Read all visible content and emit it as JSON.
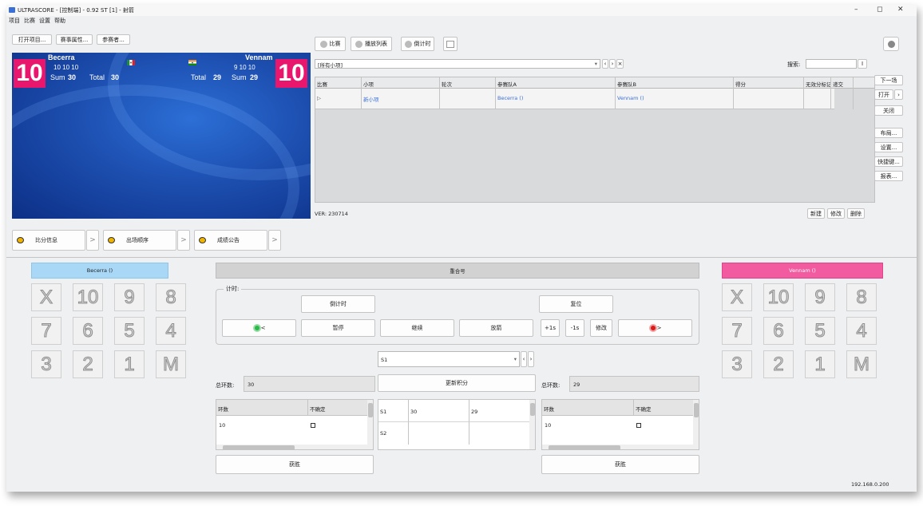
{
  "window": {
    "title": "ULTRASCORE - [控制端] - 0.92 ST [1] - 射箭",
    "controls": [
      "–",
      "◻",
      "✕"
    ]
  },
  "menu": [
    "项目",
    "比赛",
    "设置",
    "帮助"
  ],
  "top_buttons": [
    "打开项目...",
    "赛事属性...",
    "参赛者..."
  ],
  "scoreboard": {
    "left": {
      "big": "10",
      "name": "Becerra",
      "ends": "10  10  10",
      "sum_label": "Sum",
      "sum": "30",
      "total_label": "Total",
      "total": "30"
    },
    "right": {
      "big": "10",
      "name": "Vennam",
      "ends": "9  10  10",
      "sum_label": "Sum",
      "sum": "29",
      "total_label": "Total",
      "total": "29"
    }
  },
  "nav_buttons": [
    "比分信息",
    "出场顺序",
    "成绩公告"
  ],
  "toolbar": {
    "match": "比赛",
    "playlist": "播放列表",
    "countdown": "倒计时"
  },
  "filter": {
    "value": "[所有小项]",
    "search_label": "搜索:"
  },
  "grid": {
    "columns": [
      "比赛",
      "小项",
      "轮次",
      "参赛队A",
      "参赛队B",
      "得分",
      "无效分标记",
      "递交"
    ],
    "rows": [
      {
        "marker": "▷",
        "event": "新小项",
        "round": "",
        "team_a": "Becerra ()",
        "team_b": "Vennam ()",
        "score": "",
        "invalid": "",
        "submit": ""
      }
    ]
  },
  "version": "VER: 230714",
  "grid_actions": [
    "新建",
    "修改",
    "删除"
  ],
  "side_buttons": [
    "下一场",
    "打开",
    "关闭",
    "布局...",
    "设置...",
    "快捷键...",
    "报表..."
  ],
  "team_a": {
    "label": "Becerra ()",
    "color": "#a9d8f7"
  },
  "team_b": {
    "label": "Vennam ()",
    "color": "#f25ba0"
  },
  "reset_label": "重合号",
  "keypad": [
    "X",
    "10",
    "9",
    "8",
    "7",
    "6",
    "5",
    "4",
    "3",
    "2",
    "1",
    "M"
  ],
  "timer": {
    "legend": "计时:",
    "countdown": "倒计时",
    "reset": "复位",
    "prev": "<",
    "pause": "暂停",
    "resume": "继续",
    "shoot": "放箭",
    "plus1": "+1s",
    "minus1": "-1s",
    "modify": "修改",
    "next": ">"
  },
  "set_select": {
    "value": "S1"
  },
  "totals": {
    "label": "总环数:",
    "left": "30",
    "right": "29",
    "update": "更新积分"
  },
  "mini_left": {
    "col1": "环数",
    "col2": "不确定",
    "row1": "10"
  },
  "mini_right": {
    "col1": "环数",
    "col2": "不确定",
    "row1": "10"
  },
  "set_table": {
    "rows": [
      {
        "set": "S1",
        "a": "30",
        "b": "29"
      },
      {
        "set": "S2",
        "a": "",
        "b": ""
      }
    ]
  },
  "win_label": "获胜",
  "ip": "192.168.0.200"
}
